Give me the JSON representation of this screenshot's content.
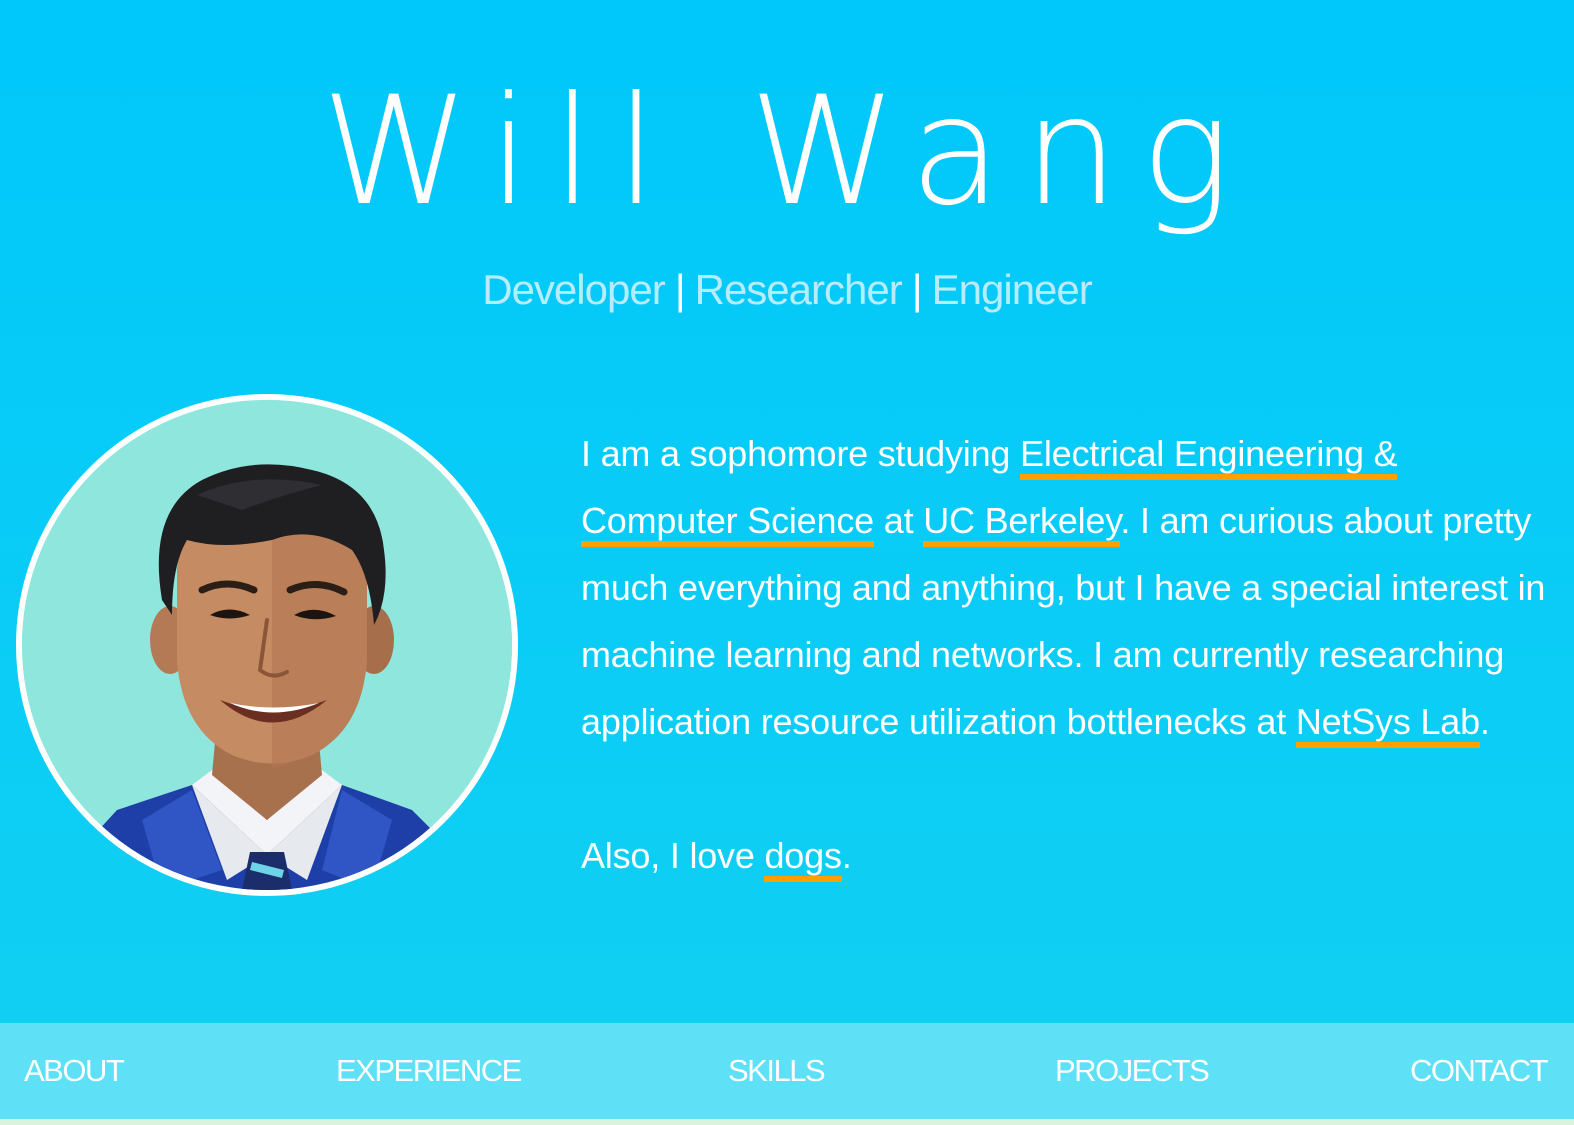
{
  "header": {
    "name": "Will Wang",
    "tagline": {
      "roles": [
        "Developer",
        "Researcher",
        "Engineer"
      ],
      "separator": "|"
    }
  },
  "avatar": {
    "alt": "Portrait of Will Wang"
  },
  "bio": {
    "paragraph1": {
      "t1": "I am a sophomore studying ",
      "link_major": "Electrical Engineering & Computer Science",
      "t2": " at ",
      "link_school": "UC Berkeley",
      "t3": ". I am curious about pretty much everything and anything, but I have a special interest in machine learning and networks. I am currently researching application resource utilization bottlenecks at ",
      "link_lab": "NetSys Lab",
      "t4": "."
    },
    "paragraph2": {
      "t1": "Also, I love ",
      "link_dogs": "dogs",
      "t2": "."
    }
  },
  "nav": {
    "items": [
      "ABOUT",
      "EXPERIENCE",
      "SKILLS",
      "PROJECTS",
      "CONTACT"
    ]
  },
  "colors": {
    "background": "#00c8fb",
    "nav_background": "#5ee0f6",
    "link_underline": "#ff9f00",
    "tagline": "#b7ecfb",
    "avatar_background": "#8fe6dd"
  }
}
